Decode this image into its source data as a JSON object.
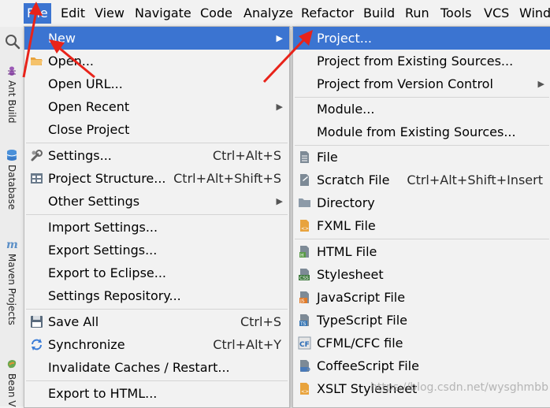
{
  "menubar": {
    "items": [
      {
        "label": "File",
        "active": true
      },
      {
        "label": "Edit"
      },
      {
        "label": "View"
      },
      {
        "label": "Navigate"
      },
      {
        "label": "Code"
      },
      {
        "label": "Analyze"
      },
      {
        "label": "Refactor"
      },
      {
        "label": "Build"
      },
      {
        "label": "Run"
      },
      {
        "label": "Tools"
      },
      {
        "label": "VCS"
      },
      {
        "label": "Wind"
      }
    ]
  },
  "sidebar": {
    "tabs": [
      {
        "label": "Ant Build",
        "icon": "ant-icon"
      },
      {
        "label": "Database",
        "icon": "database-icon"
      },
      {
        "label": "Maven Projects",
        "icon": "maven-icon"
      },
      {
        "label": "Bean V",
        "icon": "bean-icon"
      }
    ]
  },
  "file_menu": {
    "items": [
      {
        "label": "New",
        "selected": true,
        "submenu": true
      },
      {
        "label": "Open...",
        "icon": "folder-icon"
      },
      {
        "label": "Open URL..."
      },
      {
        "label": "Open Recent",
        "submenu": true
      },
      {
        "label": "Close Project"
      },
      {
        "label": "Settings...",
        "shortcut": "Ctrl+Alt+S",
        "icon": "wrench-icon"
      },
      {
        "label": "Project Structure...",
        "shortcut": "Ctrl+Alt+Shift+S",
        "icon": "project-structure-icon"
      },
      {
        "label": "Other Settings",
        "submenu": true
      },
      {
        "label": "Import Settings..."
      },
      {
        "label": "Export Settings..."
      },
      {
        "label": "Export to Eclipse..."
      },
      {
        "label": "Settings Repository..."
      },
      {
        "label": "Save All",
        "shortcut": "Ctrl+S",
        "icon": "save-icon"
      },
      {
        "label": "Synchronize",
        "shortcut": "Ctrl+Alt+Y",
        "icon": "sync-icon"
      },
      {
        "label": "Invalidate Caches / Restart..."
      },
      {
        "label": "Export to HTML..."
      }
    ]
  },
  "new_submenu": {
    "items": [
      {
        "label": "Project...",
        "selected": true
      },
      {
        "label": "Project from Existing Sources..."
      },
      {
        "label": "Project from Version Control",
        "submenu": true
      },
      {
        "label": "Module..."
      },
      {
        "label": "Module from Existing Sources..."
      },
      {
        "label": "File",
        "icon": "file-icon"
      },
      {
        "label": "Scratch File",
        "shortcut": "Ctrl+Alt+Shift+Insert",
        "icon": "scratch-file-icon"
      },
      {
        "label": "Directory",
        "icon": "directory-icon"
      },
      {
        "label": "FXML File",
        "icon": "fxml-file-icon"
      },
      {
        "label": "HTML File",
        "icon": "html-file-icon"
      },
      {
        "label": "Stylesheet",
        "icon": "css-file-icon"
      },
      {
        "label": "JavaScript File",
        "icon": "js-file-icon"
      },
      {
        "label": "TypeScript File",
        "icon": "ts-file-icon"
      },
      {
        "label": "CFML/CFC file",
        "icon": "cfml-file-icon"
      },
      {
        "label": "CoffeeScript File",
        "icon": "coffeescript-file-icon"
      },
      {
        "label": "XSLT Stylesheet",
        "icon": "xslt-file-icon"
      }
    ]
  },
  "watermark": "https://blog.csdn.net/wysghmbb",
  "colors": {
    "selection": "#3b74d1",
    "menu_bg": "#f2f2f2",
    "arrow": "#e8231a"
  }
}
